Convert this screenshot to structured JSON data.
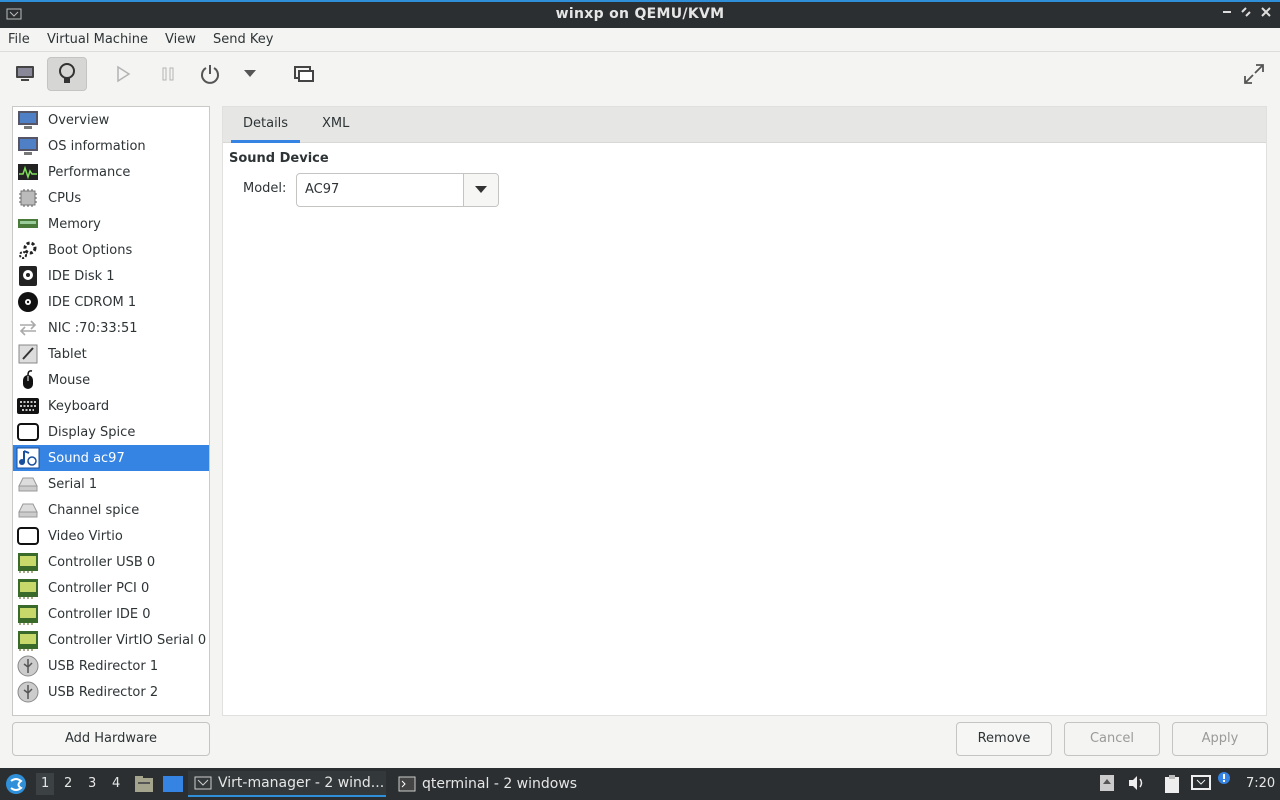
{
  "window": {
    "title": "winxp on QEMU/KVM"
  },
  "menu": [
    "File",
    "Virtual Machine",
    "View",
    "Send Key"
  ],
  "toolbar": {
    "icons": [
      "monitor-icon",
      "lightbulb-icon",
      "play-icon",
      "pause-icon",
      "power-icon",
      "chevron-down-icon",
      "screens-icon",
      "fullscreen-icon"
    ]
  },
  "sidebar": {
    "selected_index": 13,
    "items": [
      {
        "label": "Overview",
        "icon": "monitor-icon"
      },
      {
        "label": "OS information",
        "icon": "monitor-icon"
      },
      {
        "label": "Performance",
        "icon": "performance-icon"
      },
      {
        "label": "CPUs",
        "icon": "cpu-icon"
      },
      {
        "label": "Memory",
        "icon": "memory-icon"
      },
      {
        "label": "Boot Options",
        "icon": "gear-icon"
      },
      {
        "label": "IDE Disk 1",
        "icon": "disk-icon"
      },
      {
        "label": "IDE CDROM 1",
        "icon": "cdrom-icon"
      },
      {
        "label": "NIC :70:33:51",
        "icon": "network-icon"
      },
      {
        "label": "Tablet",
        "icon": "tablet-icon"
      },
      {
        "label": "Mouse",
        "icon": "mouse-icon"
      },
      {
        "label": "Keyboard",
        "icon": "keyboard-icon"
      },
      {
        "label": "Display Spice",
        "icon": "display-icon"
      },
      {
        "label": "Sound ac97",
        "icon": "sound-icon"
      },
      {
        "label": "Serial 1",
        "icon": "serial-icon"
      },
      {
        "label": "Channel spice",
        "icon": "serial-icon"
      },
      {
        "label": "Video Virtio",
        "icon": "display-icon"
      },
      {
        "label": "Controller USB 0",
        "icon": "controller-icon"
      },
      {
        "label": "Controller PCI 0",
        "icon": "controller-icon"
      },
      {
        "label": "Controller IDE 0",
        "icon": "controller-icon"
      },
      {
        "label": "Controller VirtIO Serial 0",
        "icon": "controller-icon"
      },
      {
        "label": "USB Redirector 1",
        "icon": "usb-icon"
      },
      {
        "label": "USB Redirector 2",
        "icon": "usb-icon"
      }
    ]
  },
  "tabs": [
    {
      "label": "Details",
      "active": true
    },
    {
      "label": "XML",
      "active": false
    }
  ],
  "details": {
    "section_title": "Sound Device",
    "model_label": "Model:",
    "model_value": "AC97"
  },
  "buttons": {
    "add_hardware": "Add Hardware",
    "remove": "Remove",
    "cancel": "Cancel",
    "apply": "Apply"
  },
  "taskbar": {
    "workspaces": [
      "1",
      "2",
      "3",
      "4"
    ],
    "current_workspace": "1",
    "tasks": [
      {
        "label": "Virt-manager - 2 wind...",
        "active": true
      },
      {
        "label": "qterminal - 2 windows",
        "active": false
      }
    ],
    "clock": "7:20"
  },
  "colors": {
    "accent": "#3584e4",
    "titlebar": "#2b2f31",
    "panel_bg": "#f4f4f3"
  }
}
